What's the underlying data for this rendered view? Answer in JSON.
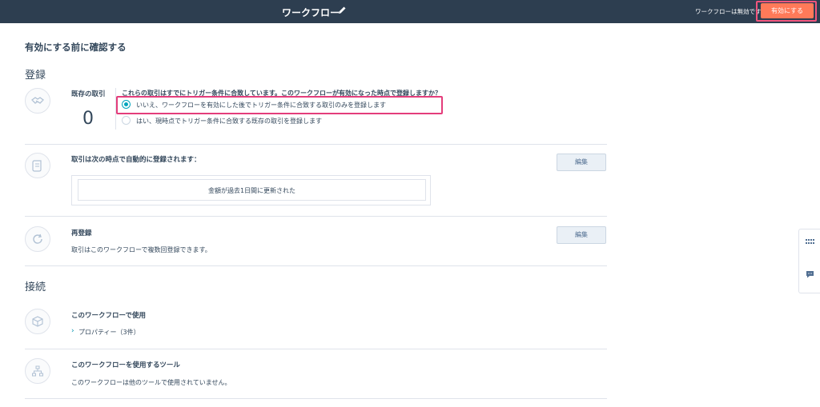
{
  "header": {
    "workflow_title": "ワークフロー",
    "status_text": "ワークフローは無効です",
    "activate_label": "有効にする"
  },
  "page_title": "有効にする前に確認する",
  "enrollment": {
    "section_title": "登録",
    "existing": {
      "label": "既存の取引",
      "count": "0",
      "question": "これらの取引はすでにトリガー条件に合致しています。このワークフローが有効になった時点で登録しますか？",
      "options": [
        {
          "label": "いいえ、ワークフローを有効にした後でトリガー条件に合致する取引のみを登録します",
          "selected": true
        },
        {
          "label": "はい、現時点でトリガー条件に合致する既存の取引を登録します",
          "selected": false
        }
      ]
    },
    "auto": {
      "title": "取引は次の時点で自動的に登録されます：",
      "edit_label": "編集",
      "criteria": "金額が過去1日間に更新された"
    },
    "reenroll": {
      "title": "再登録",
      "description": "取引はこのワークフローで複数回登録できます。",
      "edit_label": "編集"
    }
  },
  "connections": {
    "section_title": "接続",
    "used_in": {
      "title": "このワークフローで使用",
      "item": "プロパティー（3件）"
    },
    "tools": {
      "title": "このワークフローを使用するツール",
      "description": "このワークフローは他のツールで使用されていません。"
    }
  }
}
